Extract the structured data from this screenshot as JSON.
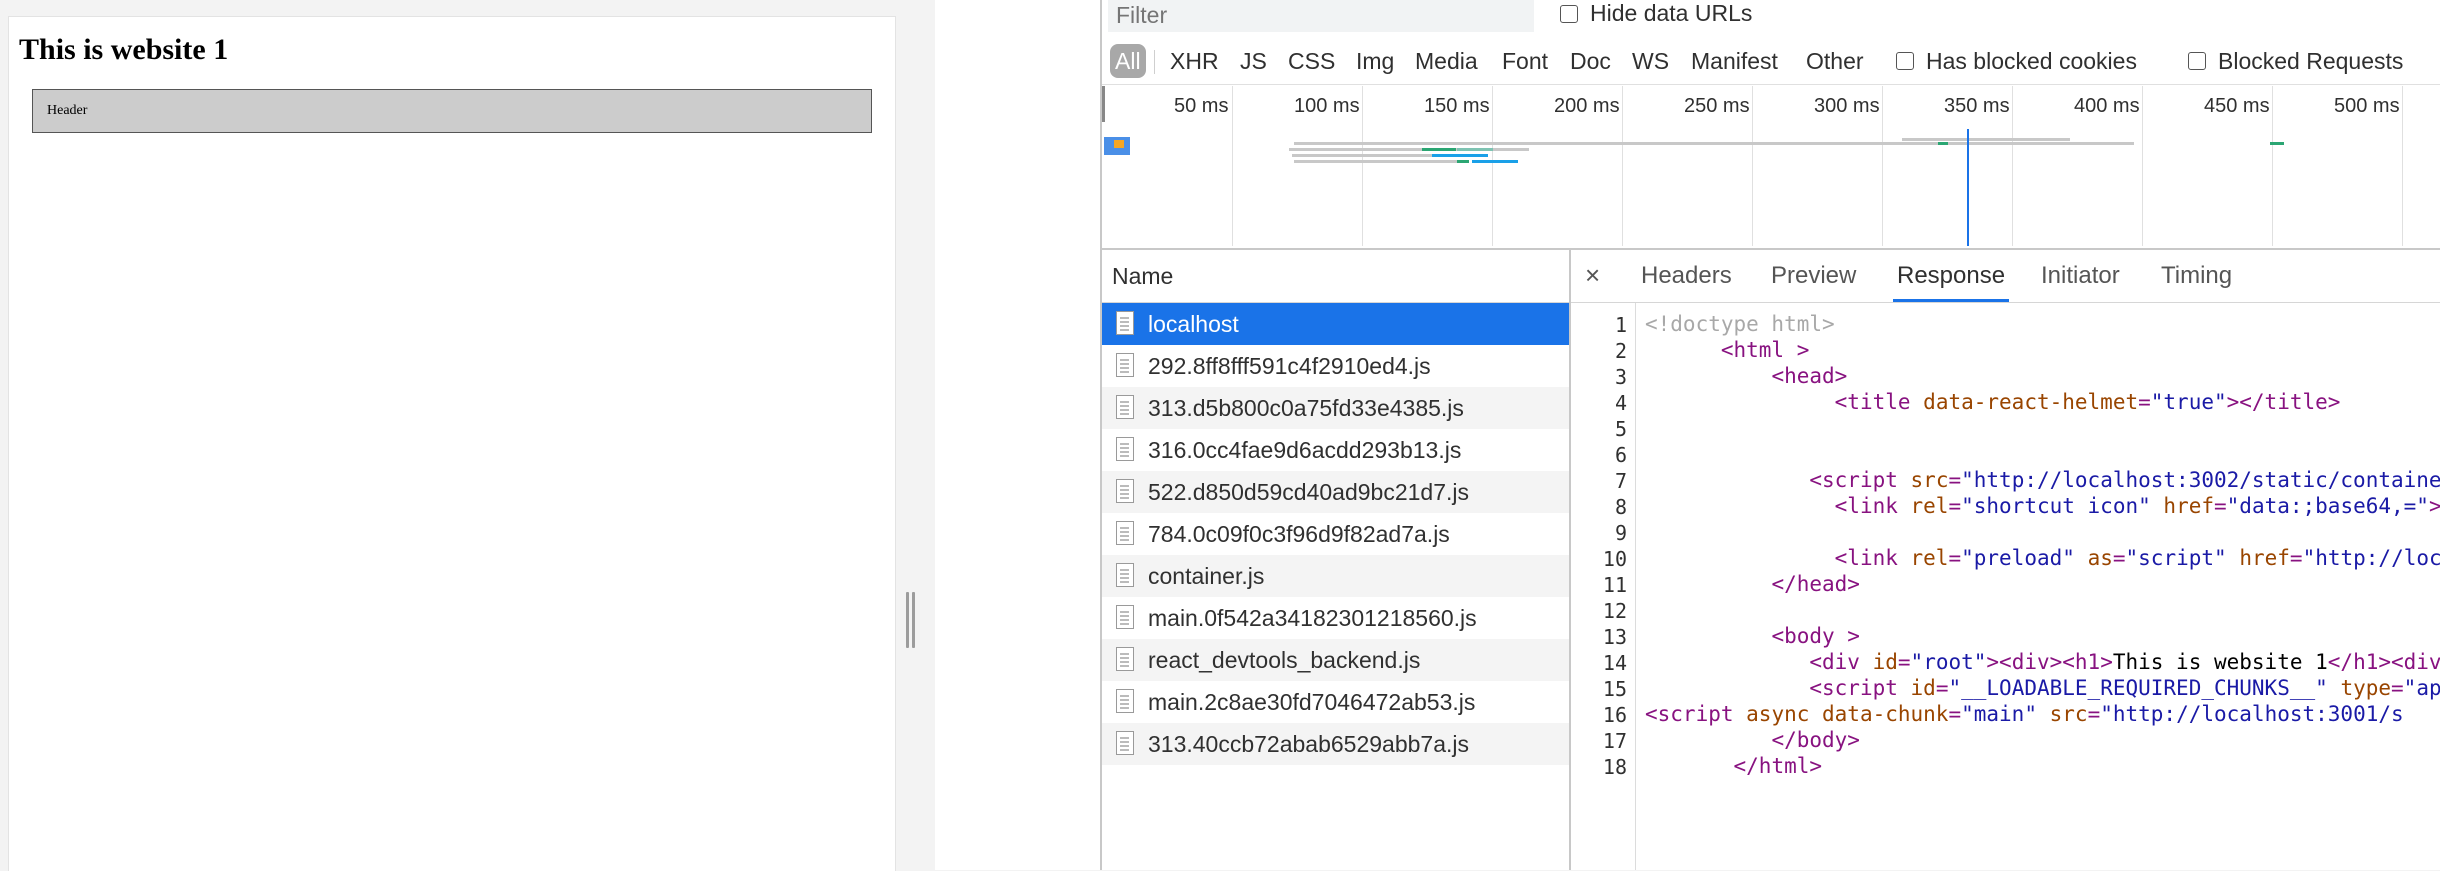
{
  "page": {
    "title": "This is website 1",
    "header_text": "Header"
  },
  "devtools": {
    "filter_placeholder": "Filter",
    "hide_data_urls": "Hide data URLs",
    "types": {
      "all": "All",
      "xhr": "XHR",
      "js": "JS",
      "css": "CSS",
      "img": "Img",
      "media": "Media",
      "font": "Font",
      "doc": "Doc",
      "ws": "WS",
      "manifest": "Manifest",
      "other": "Other"
    },
    "has_blocked_cookies": "Has blocked cookies",
    "blocked_requests": "Blocked Requests",
    "timeline_ticks": [
      "50 ms",
      "100 ms",
      "150 ms",
      "200 ms",
      "250 ms",
      "300 ms",
      "350 ms",
      "400 ms",
      "450 ms",
      "500 ms"
    ],
    "name_header": "Name",
    "requests": [
      "localhost",
      "292.8ff8fff591c4f2910ed4.js",
      "313.d5b800c0a75fd33e4385.js",
      "316.0cc4fae9d6acdd293b13.js",
      "522.d850d59cd40ad9bc21d7.js",
      "784.0c09f0c3f96d9f82ad7a.js",
      "container.js",
      "main.0f542a34182301218560.js",
      "react_devtools_backend.js",
      "main.2c8ae30fd7046472ab53.js",
      "313.40ccb72abab6529abb7a.js"
    ],
    "selected_request": "localhost",
    "detail_tabs": {
      "close": "×",
      "headers": "Headers",
      "preview": "Preview",
      "response": "Response",
      "initiator": "Initiator",
      "timing": "Timing"
    },
    "active_tab": "Response",
    "line_numbers": [
      "1",
      "2",
      "3",
      "4",
      "5",
      "6",
      "7",
      "8",
      "9",
      "10",
      "11",
      "12",
      "13",
      "14",
      "15",
      "16",
      "17",
      "18"
    ],
    "colors": {
      "accent": "#1a73e8",
      "tag": "#881280",
      "attr": "#994500",
      "value": "#1a1aa6"
    }
  }
}
